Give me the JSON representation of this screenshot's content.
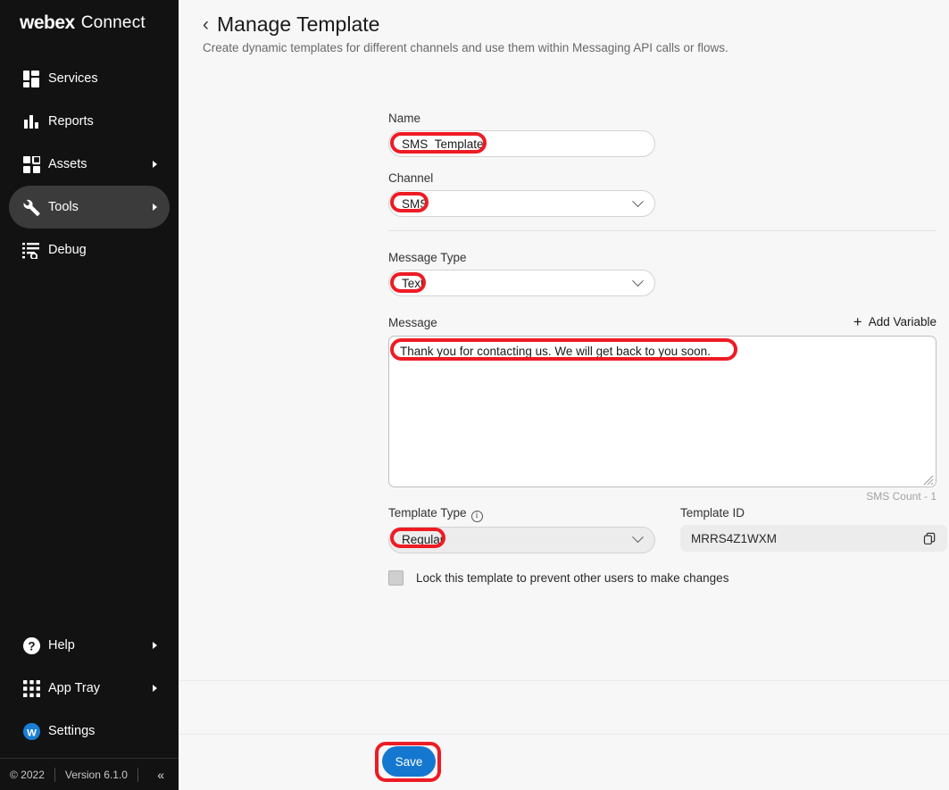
{
  "sidebar": {
    "brand": {
      "primary": "webex",
      "secondary": "Connect"
    },
    "top_items": [
      {
        "label": "Services",
        "icon": "services-icon",
        "active": false,
        "caret": false
      },
      {
        "label": "Reports",
        "icon": "reports-icon",
        "active": false,
        "caret": false
      },
      {
        "label": "Assets",
        "icon": "assets-icon",
        "active": false,
        "caret": true
      },
      {
        "label": "Tools",
        "icon": "tools-icon",
        "active": true,
        "caret": true
      },
      {
        "label": "Debug",
        "icon": "debug-icon",
        "active": false,
        "caret": false
      }
    ],
    "bottom_items": [
      {
        "label": "Help",
        "icon": "help-icon",
        "caret": true
      },
      {
        "label": "App Tray",
        "icon": "app-tray-icon",
        "caret": true
      },
      {
        "label": "Settings",
        "icon": "webex-settings-icon",
        "caret": false
      }
    ],
    "footer": {
      "copyright": "© 2022",
      "version": "Version 6.1.0",
      "collapse_icon": "«"
    }
  },
  "header": {
    "back_icon": "chevron-left-icon",
    "title": "Manage Template",
    "subtitle": "Create dynamic templates for different channels and use them within Messaging API calls or flows."
  },
  "form": {
    "name": {
      "label": "Name",
      "value": "SMS_Template",
      "placeholder": ""
    },
    "channel": {
      "label": "Channel",
      "value": "SMS"
    },
    "message_type": {
      "label": "Message Type",
      "value": "Text"
    },
    "message": {
      "label": "Message",
      "add_variable_label": "Add Variable",
      "value": "Thank you for contacting us. We will get back to you soon.",
      "sms_count": "SMS Count - 1"
    },
    "template_type": {
      "label": "Template Type",
      "info_icon": "info-icon",
      "value": "Regular"
    },
    "template_id": {
      "label": "Template ID",
      "value": "MRRS4Z1WXM",
      "copy_icon": "copy-icon"
    },
    "lock_checkbox": {
      "label": "Lock this template to prevent other users to make changes",
      "checked": false
    }
  },
  "actions": {
    "save_label": "Save"
  },
  "colors": {
    "sidebar_bg": "#121212",
    "accent_blue": "#1478d0",
    "annotation_red": "#ee1b24",
    "page_bg": "#f7f7f7"
  }
}
